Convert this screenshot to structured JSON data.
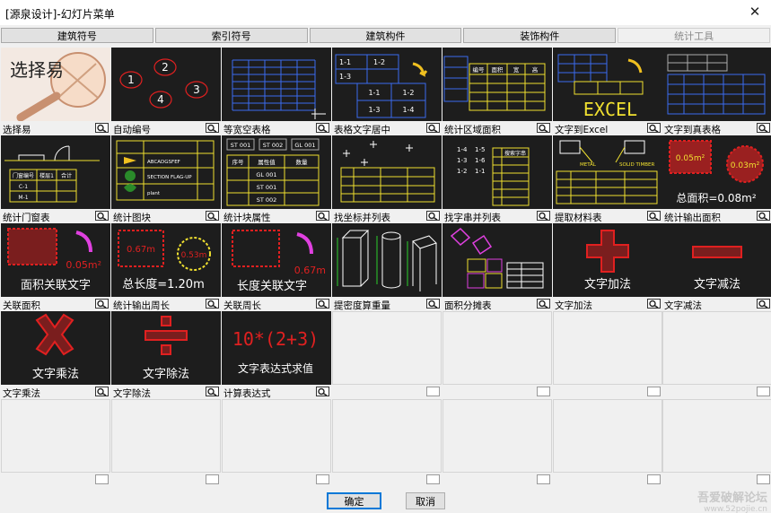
{
  "window": {
    "title": "[源泉设计]-幻灯片菜单"
  },
  "tabs": [
    "建筑符号",
    "索引符号",
    "建筑构件",
    "装饰构件",
    "统计工具"
  ],
  "items": [
    {
      "caption": "选择易",
      "thumb_text": "选择易"
    },
    {
      "caption": "自动编号",
      "thumb_text": [
        "1",
        "2",
        "3",
        "4"
      ]
    },
    {
      "caption": "等宽空表格"
    },
    {
      "caption": "表格文字居中",
      "thumb_text": [
        "1-1",
        "1-2",
        "1-3",
        "1-4"
      ]
    },
    {
      "caption": "统计区域面积",
      "thumb_text": [
        "编号",
        "面积",
        "宽",
        "高"
      ]
    },
    {
      "caption": "文字到Excel",
      "thumb_text": "EXCEL"
    },
    {
      "caption": "文字到真表格"
    },
    {
      "caption": "统计门窗表",
      "thumb_text": [
        "门窗编号",
        "楼层1",
        "合计",
        "C-1",
        "M-1"
      ]
    },
    {
      "caption": "统计图块",
      "thumb_text": [
        "ABCADGSFEF",
        "SECTION FLAG-UP",
        "plant"
      ]
    },
    {
      "caption": "统计块属性",
      "thumb_text": [
        "ST 001",
        "ST 002",
        "GL 001",
        "序号",
        "属性值",
        "数量"
      ]
    },
    {
      "caption": "找坐标并列表"
    },
    {
      "caption": "找字串并列表",
      "thumb_text": [
        "1-4",
        "1-5",
        "1-3",
        "1-6",
        "1-2",
        "1-1",
        "搜索字串"
      ]
    },
    {
      "caption": "提取材料表",
      "thumb_text": [
        "METAL",
        "SOLID TIMBER"
      ]
    },
    {
      "caption": "统计输出面积",
      "thumb_text": [
        "0.05m²",
        "0.03m²",
        "总面积=0.08m²"
      ]
    },
    {
      "caption": "关联面积",
      "thumb_text": [
        "0.05m²",
        "面积关联文字"
      ]
    },
    {
      "caption": "统计输出周长",
      "thumb_text": [
        "0.67m",
        "0.53m",
        "总长度=1.20m"
      ]
    },
    {
      "caption": "关联周长",
      "thumb_text": [
        "0.67m",
        "长度关联文字"
      ]
    },
    {
      "caption": "提密度算重量"
    },
    {
      "caption": "面积分摊表"
    },
    {
      "caption": "文字加法",
      "thumb_text": "文字加法"
    },
    {
      "caption": "文字减法",
      "thumb_text": "文字减法"
    },
    {
      "caption": "文字乘法",
      "thumb_text": "文字乘法"
    },
    {
      "caption": "文字除法",
      "thumb_text": "文字除法"
    },
    {
      "caption": "计算表达式",
      "thumb_text": [
        "10*(2+3)",
        "文字表达式求值"
      ]
    }
  ],
  "buttons": {
    "ok": "确定",
    "cancel": "取消"
  },
  "watermark": {
    "line1": "吾爱破解论坛",
    "line2": "www.52pojie.cn"
  },
  "colors": {
    "thumb_bg": "#1d1d1d",
    "accent_red": "#e02020",
    "accent_yellow": "#f0e030",
    "accent_blue": "#3a6cf0",
    "accent_magenta": "#e040e0"
  }
}
